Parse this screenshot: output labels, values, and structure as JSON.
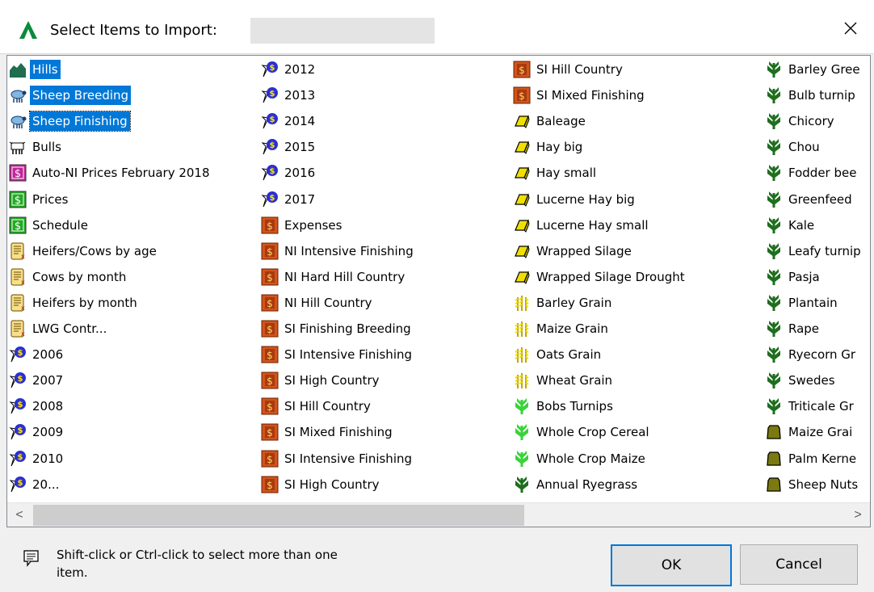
{
  "dialog": {
    "title": "Select Items to Import:",
    "title_field_value": "",
    "close_glyph": "✕"
  },
  "columns": [
    [
      {
        "label": "Hills",
        "icon": "hills-icon",
        "selected": true
      },
      {
        "label": "Sheep Breeding",
        "icon": "sheep-icon",
        "selected": true
      },
      {
        "label": "Sheep Finishing",
        "icon": "sheep-icon",
        "selected": true,
        "focused": true
      },
      {
        "label": "Bulls",
        "icon": "bull-icon"
      },
      {
        "label": "Auto-NI Prices February 2018",
        "icon": "price-magenta-icon"
      },
      {
        "label": "Prices",
        "icon": "price-green-icon"
      },
      {
        "label": "Schedule",
        "icon": "price-green-icon"
      },
      {
        "label": "Heifers/Cows by age",
        "icon": "scroll-icon"
      },
      {
        "label": "Cows by month",
        "icon": "scroll-icon"
      },
      {
        "label": "Heifers by month",
        "icon": "scroll-icon"
      },
      {
        "label": "LWG Contr...",
        "icon": "scroll-icon"
      },
      {
        "label": "2006",
        "icon": "money-bag-icon"
      },
      {
        "label": "2007",
        "icon": "money-bag-icon"
      },
      {
        "label": "2008",
        "icon": "money-bag-icon"
      },
      {
        "label": "2009",
        "icon": "money-bag-icon"
      },
      {
        "label": "2010",
        "icon": "money-bag-icon"
      },
      {
        "label": "20...",
        "icon": "money-bag-icon"
      }
    ],
    [
      {
        "label": "2012",
        "icon": "money-bag-icon"
      },
      {
        "label": "2013",
        "icon": "money-bag-icon"
      },
      {
        "label": "2014",
        "icon": "money-bag-icon"
      },
      {
        "label": "2015",
        "icon": "money-bag-icon"
      },
      {
        "label": "2016",
        "icon": "money-bag-icon"
      },
      {
        "label": "2017",
        "icon": "money-bag-icon"
      },
      {
        "label": "Expenses",
        "icon": "expense-book-icon"
      },
      {
        "label": "NI Intensive Finishing",
        "icon": "expense-book-icon"
      },
      {
        "label": "NI Hard Hill Country",
        "icon": "expense-book-icon"
      },
      {
        "label": "NI Hill Country",
        "icon": "expense-book-icon"
      },
      {
        "label": "SI Finishing Breeding",
        "icon": "expense-book-icon"
      },
      {
        "label": "SI Intensive Finishing",
        "icon": "expense-book-icon"
      },
      {
        "label": "SI High Country",
        "icon": "expense-book-icon"
      },
      {
        "label": "SI Hill Country",
        "icon": "expense-book-icon"
      },
      {
        "label": "SI Mixed Finishing",
        "icon": "expense-book-icon"
      },
      {
        "label": "SI Intensive Finishing",
        "icon": "expense-book-icon"
      },
      {
        "label": "SI High Country",
        "icon": "expense-book-icon"
      }
    ],
    [
      {
        "label": "SI Hill Country",
        "icon": "expense-book-icon"
      },
      {
        "label": "SI Mixed Finishing",
        "icon": "expense-book-icon"
      },
      {
        "label": "Baleage",
        "icon": "hay-bale-icon"
      },
      {
        "label": "Hay big",
        "icon": "hay-bale-icon"
      },
      {
        "label": "Hay small",
        "icon": "hay-bale-icon"
      },
      {
        "label": "Lucerne Hay big",
        "icon": "hay-bale-icon"
      },
      {
        "label": "Lucerne Hay small",
        "icon": "hay-bale-icon"
      },
      {
        "label": "Wrapped Silage",
        "icon": "hay-bale-icon"
      },
      {
        "label": "Wrapped Silage Drought",
        "icon": "hay-bale-icon"
      },
      {
        "label": "Barley Grain",
        "icon": "grain-icon"
      },
      {
        "label": "Maize Grain",
        "icon": "grain-icon"
      },
      {
        "label": "Oats Grain",
        "icon": "grain-icon"
      },
      {
        "label": "Wheat Grain",
        "icon": "grain-icon"
      },
      {
        "label": "Bobs Turnips",
        "icon": "crop-bright-icon"
      },
      {
        "label": "Whole Crop Cereal",
        "icon": "crop-bright-icon"
      },
      {
        "label": "Whole Crop Maize",
        "icon": "crop-bright-icon"
      },
      {
        "label": "Annual Ryegrass",
        "icon": "crop-dark-icon"
      }
    ],
    [
      {
        "label": "Barley Gree",
        "icon": "crop-dark-icon"
      },
      {
        "label": "Bulb turnip",
        "icon": "crop-dark-icon"
      },
      {
        "label": "Chicory",
        "icon": "crop-dark-icon"
      },
      {
        "label": "Chou",
        "icon": "crop-dark-icon"
      },
      {
        "label": "Fodder bee",
        "icon": "crop-dark-icon"
      },
      {
        "label": "Greenfeed",
        "icon": "crop-dark-icon"
      },
      {
        "label": "Kale",
        "icon": "crop-dark-icon"
      },
      {
        "label": "Leafy turnip",
        "icon": "crop-dark-icon"
      },
      {
        "label": "Pasja",
        "icon": "crop-dark-icon"
      },
      {
        "label": "Plantain",
        "icon": "crop-dark-icon"
      },
      {
        "label": "Rape",
        "icon": "crop-dark-icon"
      },
      {
        "label": "Ryecorn Gr",
        "icon": "crop-dark-icon"
      },
      {
        "label": "Swedes",
        "icon": "crop-dark-icon"
      },
      {
        "label": "Triticale Gr",
        "icon": "crop-dark-icon"
      },
      {
        "label": "Maize Grai",
        "icon": "feed-sack-icon"
      },
      {
        "label": "Palm Kerne",
        "icon": "feed-sack-icon"
      },
      {
        "label": "Sheep Nuts",
        "icon": "feed-sack-icon"
      }
    ]
  ],
  "scrollbar": {
    "left_arrow": "<",
    "right_arrow": ">"
  },
  "footer": {
    "hint": "Shift-click or Ctrl-click to select more than one item.",
    "ok_label": "OK",
    "cancel_label": "Cancel"
  },
  "colors": {
    "selection": "#0078d7",
    "logo_green": "#0a8a3a",
    "expense_orange": "#d2541c",
    "price_green": "#22aa22",
    "price_magenta": "#c0259a",
    "hay_yellow": "#f0e000",
    "crop_bright": "#3ad33a",
    "crop_dark": "#1e6e1e",
    "feed_olive": "#7a7a10"
  }
}
